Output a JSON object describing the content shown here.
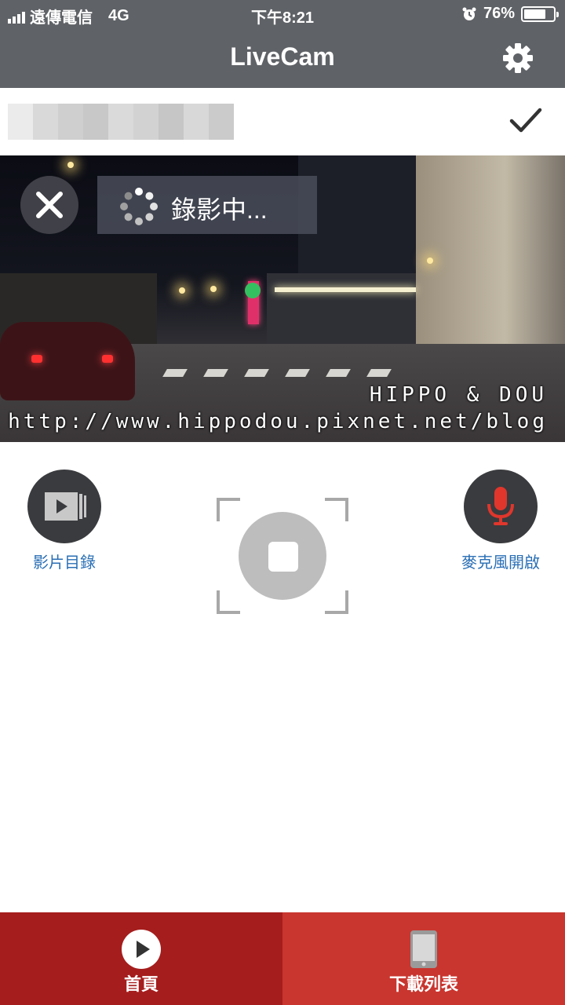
{
  "status_bar": {
    "carrier": "遠傳電信",
    "network": "4G",
    "time": "下午8:21",
    "battery_percent": "76%",
    "battery_level": 0.76,
    "icons": [
      "signal-icon",
      "alarm-icon",
      "battery-icon"
    ]
  },
  "header": {
    "title": "LiveCam",
    "settings_icon": "gear-icon"
  },
  "device_row": {
    "confirm_icon": "checkmark-icon"
  },
  "live_view": {
    "recording_status": "錄影中...",
    "close_icon": "close-icon",
    "spinner_icon": "loading-spinner-icon",
    "watermark_line1": "HIPPO & DOU",
    "watermark_line2": "http://www.hippodou.pixnet.net/blog"
  },
  "controls": {
    "video_list_label": "影片目錄",
    "video_list_icon": "video-folder-icon",
    "mic_label": "麥克風開啟",
    "mic_icon": "microphone-icon",
    "mic_color": "#e0362c",
    "stop_icon": "stop-icon"
  },
  "tabs": [
    {
      "label": "首頁",
      "icon": "play-icon",
      "active": true,
      "color": "#a51d1d"
    },
    {
      "label": "下載列表",
      "icon": "phone-icon",
      "active": false,
      "color": "#c8362f"
    }
  ]
}
